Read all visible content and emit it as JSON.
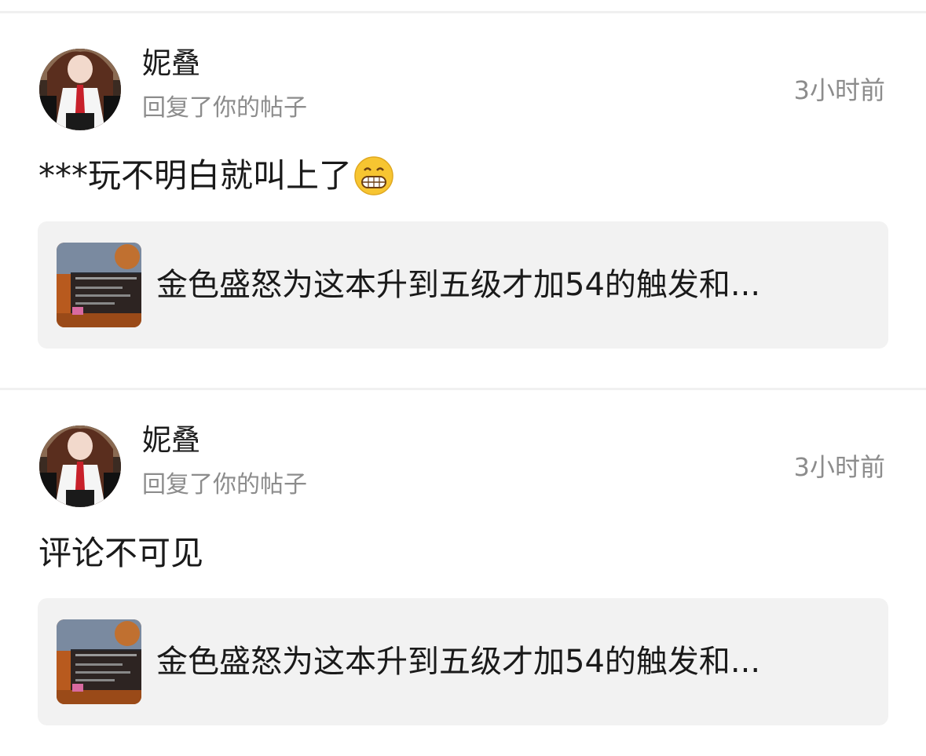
{
  "notifications": [
    {
      "username": "妮叠",
      "action": "回复了你的帖子",
      "time": "3小时前",
      "content": "***玩不明白就叫上了",
      "emoji": "grinning-face-icon",
      "post": {
        "title": "金色盛怒为这本升到五级才加54的触发和..."
      }
    },
    {
      "username": "妮叠",
      "action": "回复了你的帖子",
      "time": "3小时前",
      "content": "评论不可见",
      "post": {
        "title": "金色盛怒为这本升到五级才加54的触发和..."
      }
    }
  ],
  "colors": {
    "primary_text": "#1a1a1a",
    "secondary_text": "#8c8c8c",
    "card_background": "#f2f2f2",
    "divider": "#f0f0f0"
  }
}
